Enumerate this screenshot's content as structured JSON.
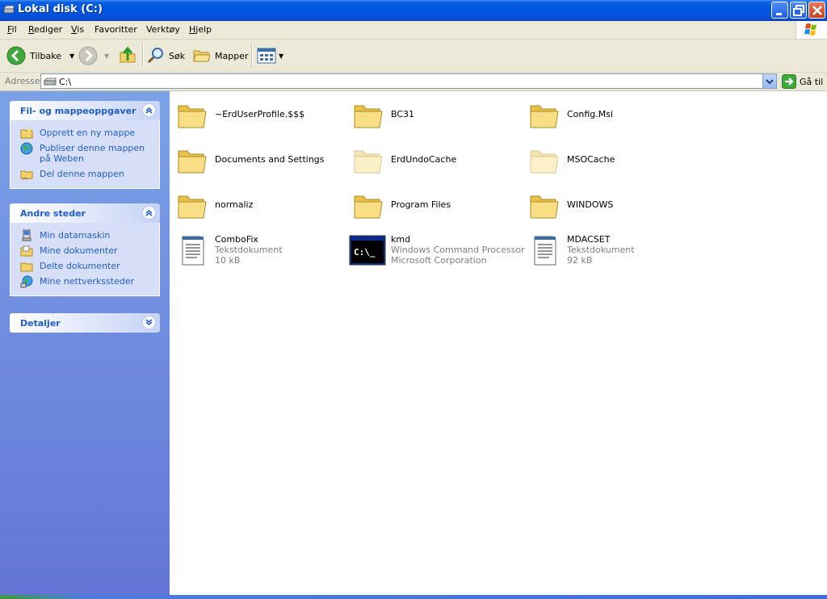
{
  "window": {
    "title": "Lokal disk (C:)"
  },
  "menu": [
    {
      "key": "F",
      "rest": "il"
    },
    {
      "key": "R",
      "rest": "ediger"
    },
    {
      "key": "V",
      "rest": "is"
    },
    {
      "key": "F",
      "rest": "avoritter",
      "full": "Favoritter"
    },
    {
      "key": "V",
      "rest": "erktøy"
    },
    {
      "key": "H",
      "rest": "jelp"
    }
  ],
  "menu_labels": [
    "Fil",
    "Rediger",
    "Vis",
    "Favoritter",
    "Verktøy",
    "Hjelp"
  ],
  "toolbar": {
    "back_label": "Tilbake",
    "search_label": "Søk",
    "folders_label": "Mapper"
  },
  "address": {
    "label": "Adresse",
    "value": "C:\\",
    "go_label": "Gå til"
  },
  "sidebar": {
    "tasks_title": "Fil- og mappeoppgaver",
    "tasks": [
      "Opprett en ny mappe",
      "Publiser denne mappen på Weben",
      "Del denne mappen"
    ],
    "places_title": "Andre steder",
    "places": [
      "Min datamaskin",
      "Mine dokumenter",
      "Delte dokumenter",
      "Mine nettverkssteder"
    ],
    "details_title": "Detaljer"
  },
  "items": [
    {
      "name": "~ErdUserProfile.$$$",
      "type": "folder"
    },
    {
      "name": "BC31",
      "type": "folder"
    },
    {
      "name": "Config.Msi",
      "type": "folder"
    },
    {
      "name": "Documents and Settings",
      "type": "folder"
    },
    {
      "name": "ErdUndoCache",
      "type": "folder-hidden"
    },
    {
      "name": "MSOCache",
      "type": "folder-hidden"
    },
    {
      "name": "normaliz",
      "type": "folder"
    },
    {
      "name": "Program Files",
      "type": "folder"
    },
    {
      "name": "WINDOWS",
      "type": "folder"
    },
    {
      "name": "ComboFix",
      "type": "text",
      "line1": "Tekstdokument",
      "line2": "10 kB"
    },
    {
      "name": "kmd",
      "type": "cmd",
      "line1": "Windows Command Processor",
      "line2": "Microsoft Corporation"
    },
    {
      "name": "MDACSET",
      "type": "text",
      "line1": "Tekstdokument",
      "line2": "92 kB"
    }
  ],
  "cmd_icon_text": "C:\\_"
}
